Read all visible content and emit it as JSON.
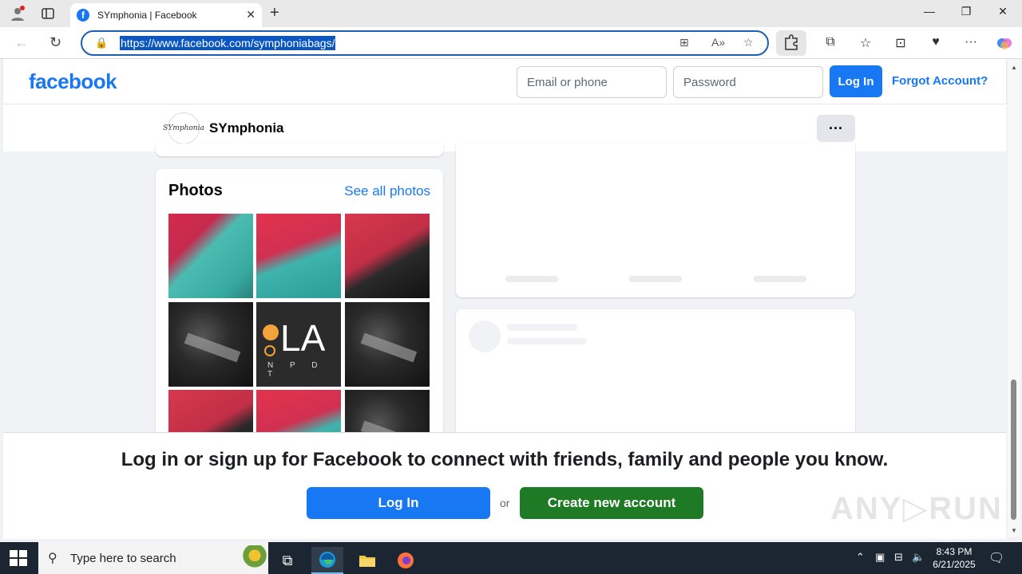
{
  "browser": {
    "tab_title": "SYmphonia | Facebook",
    "tab_favicon": "f",
    "tab_close": "✕",
    "new_tab": "+",
    "url": "https://www.facebook.com/symphoniabags/",
    "window_controls": {
      "minimize": "—",
      "restore": "❐",
      "close": "✕"
    }
  },
  "header": {
    "logo": "facebook",
    "email_placeholder": "Email or phone",
    "password_placeholder": "Password",
    "login_label": "Log In",
    "forgot_label": "Forgot Account?"
  },
  "page": {
    "avatar_text": "SYmphonia",
    "name": "SYmphonia",
    "more_label": "···"
  },
  "photos": {
    "title": "Photos",
    "see_all": "See all photos",
    "logo_tile": {
      "letters": "LA",
      "subtitle": "N P D T"
    }
  },
  "overlay": {
    "message": "Log in or sign up for Facebook to connect with friends, family and people you know.",
    "login_label": "Log In",
    "or_label": "or",
    "create_label": "Create new account",
    "watermark": "ANY▷RUN"
  },
  "taskbar": {
    "search_placeholder": "Type here to search",
    "time": "8:43 PM",
    "date": "6/21/2025"
  },
  "colors": {
    "facebook_blue": "#1877f2",
    "create_green": "#1f7a25",
    "taskbar_bg": "#1c2633"
  }
}
